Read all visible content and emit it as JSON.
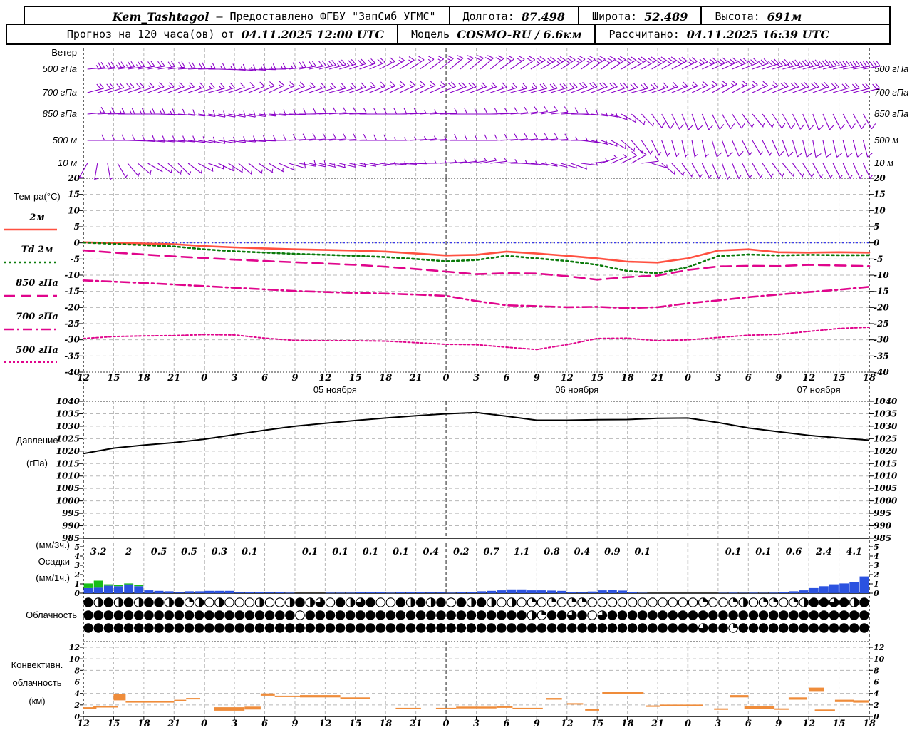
{
  "header": {
    "station": "Kem_Tashtagol",
    "separator": "—",
    "provided": "Предоставлено ФГБУ \"ЗапСиб УГМС\"",
    "lon_label": "Долгота:",
    "lon_value": "87.498",
    "lat_label": "Широта:",
    "lat_value": "52.489",
    "alt_label": "Высота:",
    "alt_value": "691м",
    "forecast_label": "Прогноз на 120 часа(ов) от",
    "forecast_time": "04.11.2025 12:00 UTC",
    "model_label": "Модель",
    "model_value": "COSMO-RU / 6.6км",
    "calc_label": "Рассчитано:",
    "calc_time": "04.11.2025 16:39 UTC"
  },
  "labels": {
    "wind_title": "Ветер",
    "wind_levels": [
      "500 гПа",
      "700 гПа",
      "850 гПа",
      "500 м",
      "10 м"
    ],
    "temp_title": "Тем-ра(°C)",
    "pressure_line1": "Давление",
    "pressure_line2": "(гПа)",
    "precip_line1": "(мм/3ч.)",
    "precip_line2": "Осадки",
    "precip_line3": "(мм/1ч.)",
    "clouds": "Облачность",
    "conv_line1": "Конвективн.",
    "conv_line2": "облачность",
    "conv_line3": "(км)"
  },
  "axis": {
    "hour_labels": [
      "12",
      "15",
      "18",
      "21",
      "0",
      "3",
      "6",
      "9",
      "12",
      "15",
      "18",
      "21",
      "0",
      "3",
      "6",
      "9",
      "12",
      "15",
      "18",
      "21",
      "0",
      "3",
      "6",
      "9",
      "12",
      "15",
      "18"
    ],
    "date_labels": [
      {
        "text": "05 ноября",
        "tick_index": 8
      },
      {
        "text": "06 ноября",
        "tick_index": 16
      },
      {
        "text": "07 ноября",
        "tick_index": 24
      }
    ]
  },
  "chart_data": [
    {
      "type": "table",
      "name": "wind_barbs",
      "units": "kt",
      "note": "dir_deg is on-screen pointing angle, 0=east, positive=up",
      "levels": [
        {
          "level": "500 гПа",
          "dir_deg": [
            5,
            8,
            10,
            5,
            0,
            -5,
            0,
            10,
            15,
            20,
            30,
            35,
            40,
            40,
            35,
            30,
            35,
            35,
            30,
            30,
            25,
            25,
            20,
            15,
            15,
            10
          ],
          "speed_kt": [
            25,
            25,
            20,
            20,
            15,
            15,
            15,
            20,
            25,
            20,
            15,
            15,
            15,
            20,
            20,
            25,
            25,
            30,
            30,
            30,
            25,
            30,
            30,
            35,
            35,
            30
          ]
        },
        {
          "level": "700 гПа",
          "dir_deg": [
            15,
            18,
            20,
            20,
            15,
            20,
            25,
            20,
            15,
            20,
            25,
            25,
            20,
            20,
            15,
            15,
            20,
            20,
            15,
            20,
            25,
            30,
            25,
            20,
            20,
            15
          ],
          "speed_kt": [
            20,
            20,
            15,
            15,
            15,
            10,
            15,
            15,
            15,
            15,
            15,
            15,
            20,
            15,
            15,
            20,
            20,
            20,
            20,
            15,
            15,
            15,
            15,
            20,
            20,
            20
          ]
        },
        {
          "level": "850 гПа",
          "dir_deg": [
            5,
            0,
            0,
            -5,
            -10,
            -10,
            -5,
            0,
            5,
            0,
            0,
            5,
            0,
            0,
            5,
            10,
            0,
            -10,
            -40,
            -60,
            -70,
            -60,
            -50,
            -60,
            -70,
            -60
          ],
          "speed_kt": [
            15,
            15,
            15,
            10,
            10,
            10,
            10,
            10,
            10,
            10,
            10,
            5,
            10,
            10,
            10,
            10,
            10,
            5,
            5,
            10,
            10,
            10,
            5,
            10,
            10,
            10
          ]
        },
        {
          "level": "500 м",
          "dir_deg": [
            0,
            0,
            -5,
            -5,
            -10,
            -5,
            0,
            5,
            5,
            0,
            0,
            5,
            0,
            0,
            5,
            5,
            0,
            -20,
            -50,
            -70,
            -80,
            -70,
            -60,
            -70,
            -80,
            -75
          ],
          "speed_kt": [
            10,
            10,
            10,
            10,
            10,
            10,
            10,
            10,
            10,
            10,
            5,
            5,
            10,
            10,
            10,
            10,
            5,
            5,
            5,
            5,
            5,
            10,
            5,
            10,
            10,
            10
          ]
        },
        {
          "level": "10 м",
          "dir_deg": [
            -120,
            -60,
            -30,
            -45,
            -20,
            -40,
            -30,
            -10,
            -15,
            -10,
            -5,
            0,
            5,
            10,
            0,
            -10,
            -20,
            20,
            30,
            -40,
            -60,
            -70,
            -60,
            -50,
            -60,
            -65
          ],
          "speed_kt": [
            5,
            5,
            5,
            5,
            5,
            5,
            5,
            10,
            5,
            5,
            5,
            5,
            5,
            5,
            5,
            5,
            5,
            5,
            10,
            5,
            5,
            5,
            5,
            5,
            5,
            5
          ]
        }
      ]
    },
    {
      "type": "line",
      "name": "temperature",
      "ylabel": "Тем-ра(°C)",
      "ylim": [
        -40,
        20
      ],
      "x_step_hours": 3,
      "zero_line_color": "#2222ee",
      "series": [
        {
          "name": "2м",
          "color": "#ff5040",
          "dash": "",
          "values": [
            0.2,
            0,
            -0.2,
            -0.4,
            -1,
            -1.4,
            -1.7,
            -2,
            -2.2,
            -2.4,
            -2.7,
            -3.3,
            -3.9,
            -3.7,
            -2.7,
            -3.3,
            -4,
            -4.8,
            -5.8,
            -6.1,
            -4.8,
            -2.4,
            -2,
            -2.9,
            -3,
            -2.9,
            -3
          ]
        },
        {
          "name": "Td 2м",
          "color": "#0a7a0a",
          "dash": "3 4",
          "values": [
            0.1,
            -0.3,
            -0.7,
            -1.1,
            -2,
            -2.6,
            -3,
            -3.4,
            -3.7,
            -4,
            -4.4,
            -5,
            -5.7,
            -5.3,
            -4,
            -4.8,
            -5.6,
            -6.8,
            -8.7,
            -9.4,
            -7.5,
            -4.1,
            -3.6,
            -3.9,
            -3.7,
            -3.8,
            -3.8
          ]
        },
        {
          "name": "850 гПа",
          "color": "#e0058c",
          "dash": "15 8",
          "values": [
            -2.3,
            -3,
            -3.6,
            -4.2,
            -4.7,
            -5.2,
            -5.6,
            -6,
            -6.4,
            -6.8,
            -7.4,
            -8.1,
            -8.9,
            -9.7,
            -9.4,
            -9.5,
            -10.3,
            -11.4,
            -10.6,
            -10.1,
            -8.4,
            -7.3,
            -7.1,
            -7.2,
            -6.8,
            -7,
            -7.2
          ]
        },
        {
          "name": "700 гПа",
          "color": "#e0058c",
          "dash": "13 5 3 5",
          "values": [
            -11.6,
            -12,
            -12.4,
            -12.9,
            -13.4,
            -13.9,
            -14.4,
            -14.9,
            -15.2,
            -15.5,
            -15.7,
            -16,
            -16.4,
            -18,
            -19.3,
            -19.6,
            -19.9,
            -19.8,
            -20.2,
            -19.9,
            -18.7,
            -17.8,
            -16.8,
            -16,
            -15.2,
            -14.5,
            -13.6
          ]
        },
        {
          "name": "500 гПа",
          "color": "#e0058c",
          "dash": "3 3",
          "values": [
            -29.6,
            -29,
            -28.8,
            -28.7,
            -28.4,
            -28.5,
            -29.5,
            -30.2,
            -30.3,
            -30.3,
            -30.4,
            -30.9,
            -31.4,
            -31.5,
            -32.3,
            -33,
            -31.5,
            -29.6,
            -29.5,
            -30.3,
            -30,
            -29.3,
            -28.6,
            -28.3,
            -27.4,
            -26.5,
            -26.1
          ]
        }
      ]
    },
    {
      "type": "line",
      "name": "pressure",
      "ylabel": "Давление (гПа)",
      "ylim": [
        985,
        1040
      ],
      "x_step_hours": 3,
      "color": "#000000",
      "values": [
        1019,
        1021.2,
        1022.4,
        1023.4,
        1024.8,
        1026.6,
        1028.4,
        1030,
        1031.2,
        1032.3,
        1033.3,
        1034.2,
        1035,
        1035.5,
        1034,
        1032.4,
        1032.4,
        1032.6,
        1032.7,
        1033.2,
        1033.3,
        1031.5,
        1029.3,
        1027.8,
        1026.3,
        1025.3,
        1024.4
      ]
    },
    {
      "type": "bar",
      "name": "precipitation",
      "ylim": [
        0,
        5
      ],
      "labels_3h": [
        3.2,
        2,
        0.5,
        0.5,
        0.3,
        0.1,
        null,
        0.1,
        0.1,
        0.1,
        0.1,
        0.4,
        0.2,
        0.7,
        1.1,
        0.8,
        0.4,
        0.9,
        0.1,
        null,
        null,
        0.1,
        0.1,
        0.6,
        2.4,
        4.1
      ],
      "colors": {
        "rain": "#2b52e0",
        "snow": "#17bd17"
      },
      "hourly_rain": [
        0.55,
        0.6,
        0.8,
        0.75,
        0.95,
        0.75,
        0.3,
        0.25,
        0.2,
        0.15,
        0.2,
        0.2,
        0.25,
        0.25,
        0.25,
        0.15,
        0.12,
        0.1,
        0.15,
        0.1,
        0.05,
        0,
        0,
        0,
        0.05,
        0.05,
        0.05,
        0.1,
        0.1,
        0.08,
        0.05,
        0.1,
        0.12,
        0.12,
        0.15,
        0.15,
        0.05,
        0.08,
        0.1,
        0.2,
        0.25,
        0.3,
        0.4,
        0.4,
        0.3,
        0.3,
        0.28,
        0.25,
        0.1,
        0.15,
        0.18,
        0.3,
        0.35,
        0.28,
        0.12,
        0.03,
        0,
        0,
        0,
        0,
        0,
        0,
        0,
        0.03,
        0.05,
        0.03,
        0.05,
        0.03,
        0.05,
        0.12,
        0.2,
        0.3,
        0.55,
        0.75,
        0.95,
        1.05,
        1.2,
        1.8
      ],
      "hourly_snow": [
        0.5,
        0.75,
        0.15,
        0.15,
        0.1,
        0.15
      ]
    },
    {
      "type": "heatmap",
      "name": "cloudiness",
      "scale": "0=clear .. 4=overcast, hourly, rows top/middle/bottom",
      "rows": [
        "424242442412020002002423042340042424042420201010110000000000010012011012443424",
        "444444444444444444444044444444444444444444442144340344444444444444444444444444",
        "444444444444444444444444444444444444444444444444444444444444434414444444444444"
      ]
    },
    {
      "type": "segments",
      "name": "convective_clouds",
      "ylim": [
        0,
        13
      ],
      "units": "km",
      "color": "#ef8c3a",
      "segments_km": [
        [
          0,
          1.3,
          1.4,
          1.6
        ],
        [
          1,
          3.4,
          1.6,
          1.8
        ],
        [
          3,
          4.2,
          2.8,
          3.9
        ],
        [
          4.2,
          9,
          2.4,
          2.7
        ],
        [
          9,
          10.2,
          2.7,
          2.9
        ],
        [
          10.2,
          11.6,
          3,
          3.2
        ],
        [
          13,
          16,
          1,
          1.6
        ],
        [
          16,
          17.6,
          1.2,
          1.7
        ],
        [
          17.6,
          19,
          3.6,
          4
        ],
        [
          19,
          21.5,
          3.4,
          3.6
        ],
        [
          21.5,
          25.5,
          3.3,
          3.7
        ],
        [
          25.5,
          28.5,
          3,
          3.3
        ],
        [
          31,
          33.5,
          1.3,
          1.5
        ],
        [
          35,
          37,
          1.35,
          1.5
        ],
        [
          37,
          41,
          1.4,
          1.7
        ],
        [
          41,
          42.6,
          1.5,
          1.8
        ],
        [
          42.6,
          45.6,
          1.3,
          1.5
        ],
        [
          45.9,
          47.5,
          2.9,
          3.2
        ],
        [
          48,
          49.6,
          2.1,
          2.3
        ],
        [
          49.8,
          51.2,
          1.1,
          1.25
        ],
        [
          51.5,
          55.6,
          3.9,
          4.3
        ],
        [
          55.8,
          57.2,
          1.8,
          1.9
        ],
        [
          57.2,
          61.5,
          1.9,
          2.05
        ],
        [
          62.6,
          64,
          1.3,
          1.4
        ],
        [
          64.2,
          66,
          3.3,
          3.7
        ],
        [
          65.6,
          68.6,
          1.3,
          1.8
        ],
        [
          68.6,
          70,
          1.2,
          1.4
        ],
        [
          70,
          71.8,
          2.9,
          3.3
        ],
        [
          72,
          73.5,
          4.4,
          5
        ],
        [
          72.6,
          74.6,
          1.1,
          1.2
        ],
        [
          74.6,
          76.5,
          2.5,
          2.9
        ],
        [
          76.4,
          78,
          2.4,
          2.8
        ]
      ]
    }
  ]
}
